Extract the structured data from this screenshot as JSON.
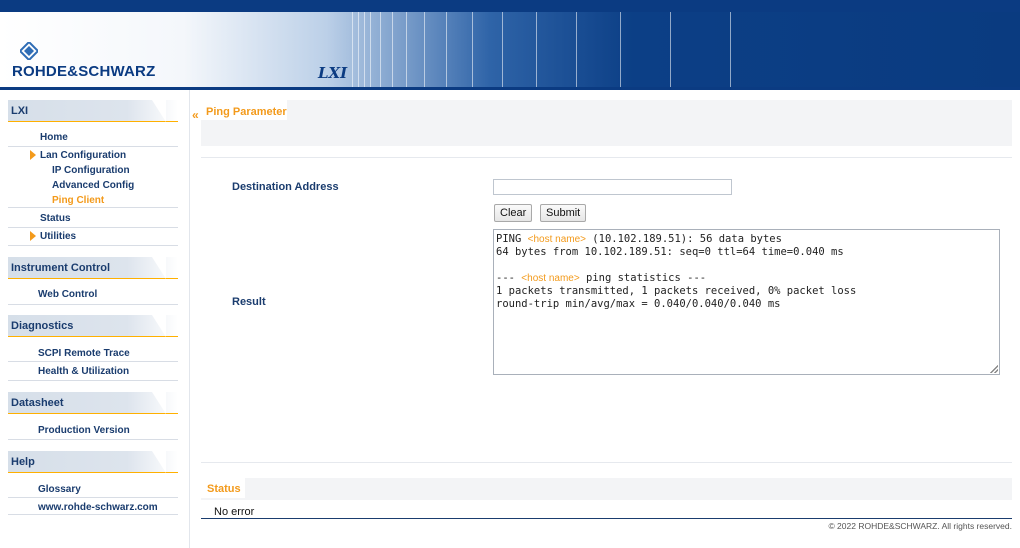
{
  "brand": {
    "logo_text": "ROHDE&SCHWARZ",
    "product_text": "LXI"
  },
  "sidebar": {
    "sections": [
      {
        "title": "LXI",
        "items": [
          {
            "label": "Home"
          },
          {
            "label": "Lan Configuration",
            "expanded": true
          },
          {
            "label": "IP Configuration"
          },
          {
            "label": "Advanced Config"
          },
          {
            "label": "Ping Client",
            "active": true
          },
          {
            "label": "Status"
          },
          {
            "label": "Utilities"
          }
        ]
      },
      {
        "title": "Instrument Control",
        "items": [
          {
            "label": "Web Control"
          }
        ]
      },
      {
        "title": "Diagnostics",
        "items": [
          {
            "label": "SCPI Remote Trace"
          },
          {
            "label": "Health & Utilization"
          }
        ]
      },
      {
        "title": "Datasheet",
        "items": [
          {
            "label": "Production Version"
          }
        ]
      },
      {
        "title": "Help",
        "items": [
          {
            "label": "Glossary"
          },
          {
            "label": "www.rohde-schwarz.com"
          }
        ]
      }
    ]
  },
  "main": {
    "tab_title": "Ping Parameter",
    "destination_label": "Destination Address",
    "destination_value": "",
    "clear_label": "Clear",
    "submit_label": "Submit",
    "result_label": "Result",
    "result": {
      "line1_pre": "PING ",
      "host_placeholder": "<host name>",
      "line1_post": " (10.102.189.51): 56 data bytes",
      "line2": "64 bytes from 10.102.189.51: seq=0 ttl=64 time=0.040 ms",
      "line4_pre": "--- ",
      "line4_post": " ping statistics ---",
      "line5": "1 packets transmitted, 1 packets received, 0% packet loss",
      "line6": "round-trip min/avg/max = 0.040/0.040/0.040 ms"
    }
  },
  "status": {
    "tab_title": "Status",
    "message": "No error"
  },
  "footer": {
    "copyright": "© 2022 ROHDE&SCHWARZ. All rights reserved."
  },
  "colors": {
    "accent": "#f39a1b",
    "navy": "#1a3c6e",
    "header_blue": "#0b3b82"
  }
}
